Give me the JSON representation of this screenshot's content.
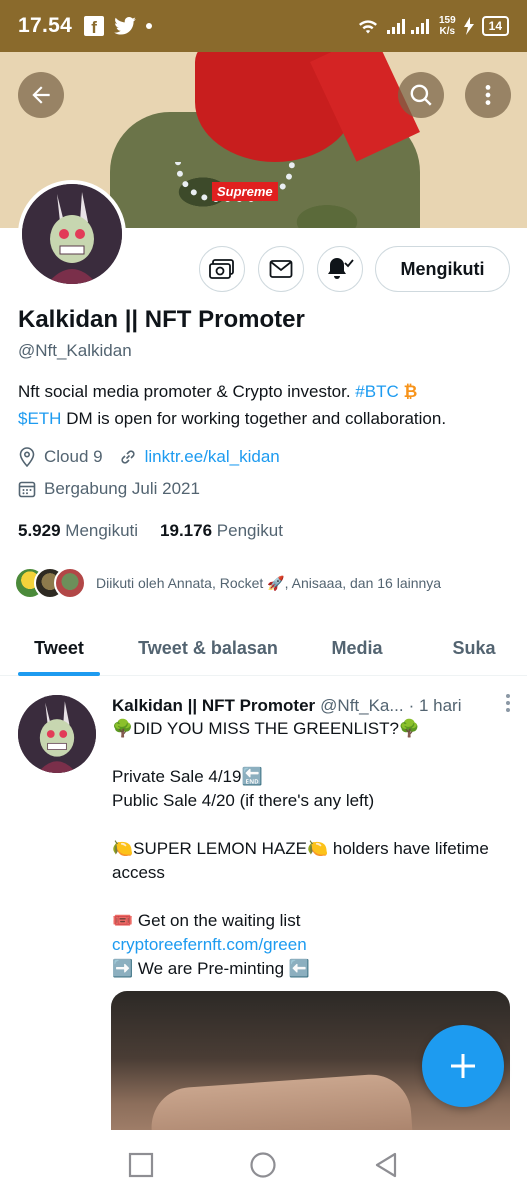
{
  "status_bar": {
    "time": "17.54",
    "network_speed_value": "159",
    "network_speed_unit": "K/s",
    "battery": "14"
  },
  "banner": {
    "brand_text": "Supreme"
  },
  "header_buttons": {
    "back_icon": "arrow-left-icon",
    "search_icon": "search-icon",
    "more_icon": "more-vertical-icon"
  },
  "actions": {
    "follow_label": "Mengikuti"
  },
  "profile": {
    "name": "Kalkidan || NFT Promoter",
    "handle": "@Nft_Kalkidan",
    "bio_text1": "Nft social media promoter & Crypto investor. ",
    "bio_tag1": "#BTC",
    "bio_emoji": "₿",
    "bio_tag2": "$ETH",
    "bio_text2": " DM is open for working together and collaboration.",
    "location": "Cloud 9",
    "link": "linktr.ee/kal_kidan",
    "joined": "Bergabung Juli 2021",
    "following_count": "5.929",
    "following_label": "Mengikuti",
    "followers_count": "19.176",
    "followers_label": "Pengikut",
    "followed_by_text": "Diikuti oleh Annata, Rocket 🚀, Anisaaa, dan 16 lainnya"
  },
  "tabs": [
    {
      "label": "Tweet",
      "active": true
    },
    {
      "label": "Tweet & balasan",
      "active": false
    },
    {
      "label": "Media",
      "active": false
    },
    {
      "label": "Suka",
      "active": false
    }
  ],
  "tweet": {
    "author_name": "Kalkidan || NFT Promoter",
    "author_handle": "@Nft_Ka...",
    "time": "· 1 hari",
    "line1": "🌳DID YOU MISS THE GREENLIST?🌳",
    "line2": "Private Sale 4/19🔚",
    "line3": "Public Sale 4/20 (if there's any left)",
    "line4": "🍋SUPER LEMON HAZE🍋 holders have lifetime access",
    "line5": "🎟️ Get on the waiting list",
    "line6_link": "cryptoreefernft.com/green",
    "line7": "➡️ We are Pre-minting ⬅️"
  },
  "colors": {
    "accent": "#1d9bf0",
    "status_bar": "#8a6a2c",
    "secondary_text": "#536471"
  }
}
